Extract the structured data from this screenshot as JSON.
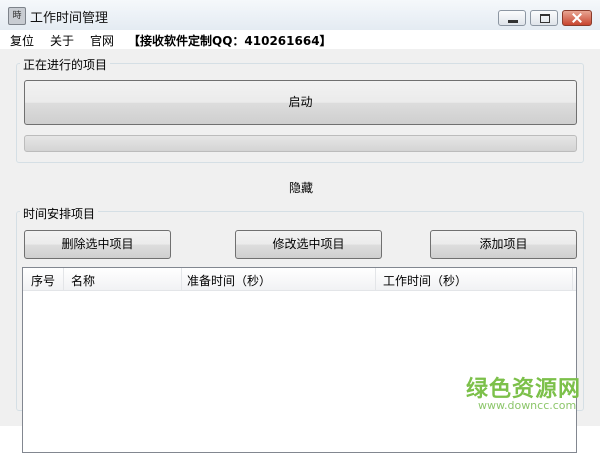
{
  "window": {
    "title": "工作时间管理",
    "icon": "app-icon",
    "controls": [
      "minimize-icon",
      "maximize-icon",
      "close-icon"
    ]
  },
  "menu": {
    "items": [
      "复位",
      "关于",
      "官网"
    ],
    "contact": "【接收软件定制QQ：410261664】"
  },
  "running_group": {
    "title": "正在进行的项目",
    "start_button": "启动",
    "progress": 0
  },
  "hide_label": "隐藏",
  "schedule_group": {
    "title": "时间安排项目",
    "buttons": {
      "delete": "删除选中项目",
      "modify": "修改选中项目",
      "add": "添加项目"
    },
    "columns": [
      "序号",
      "名称",
      "准备时间（秒）",
      "工作时间（秒）"
    ],
    "rows": []
  },
  "watermark": {
    "text": "绿色资源网",
    "url": "www.downcc.com",
    "color": "#7cc04a"
  }
}
